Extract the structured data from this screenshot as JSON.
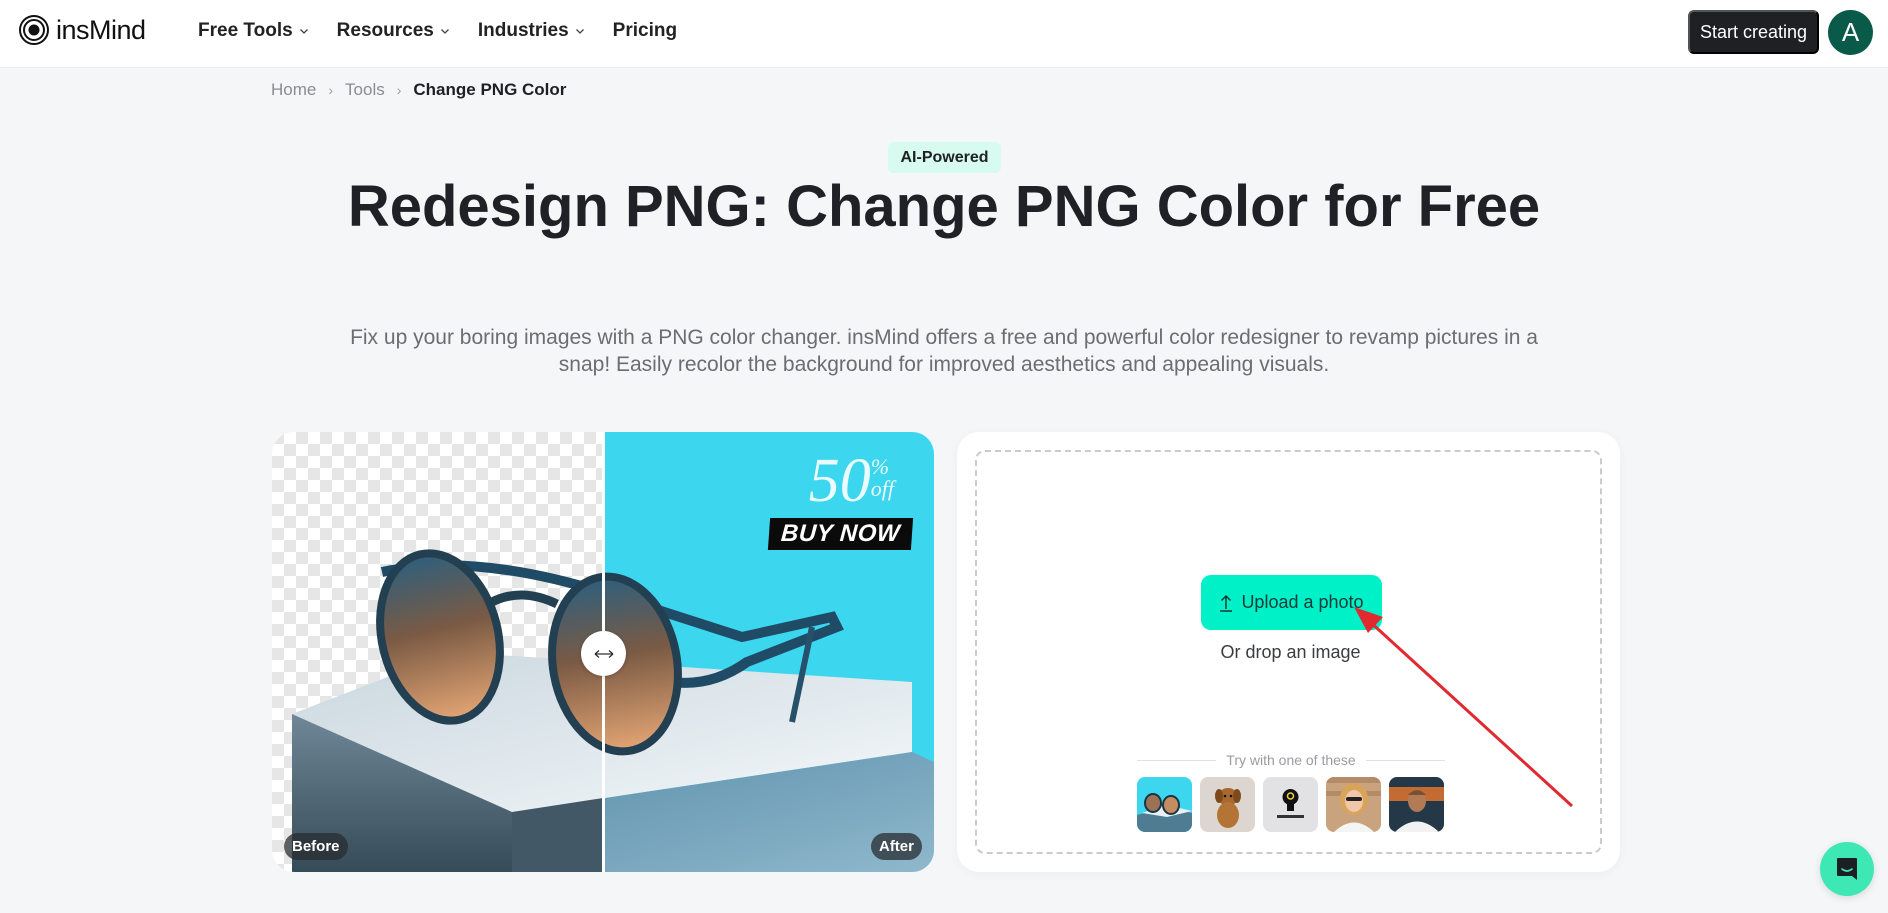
{
  "nav": {
    "brand": "insMind",
    "menu": [
      {
        "label": "Free Tools",
        "has_dropdown": true
      },
      {
        "label": "Resources",
        "has_dropdown": true
      },
      {
        "label": "Industries",
        "has_dropdown": true
      },
      {
        "label": "Pricing",
        "has_dropdown": false
      }
    ],
    "cta_label": "Start creating",
    "avatar_initial": "A"
  },
  "breadcrumb": {
    "items": [
      "Home",
      "Tools"
    ],
    "current": "Change PNG Color"
  },
  "hero": {
    "badge": "AI-Powered",
    "title": "Redesign PNG: Change PNG Color for Free",
    "subtitle": "Fix up your boring images with a PNG color changer. insMind offers a free and powerful color redesigner to revamp pictures in a snap! Easily recolor the background for improved aesthetics and appealing visuals."
  },
  "comparison": {
    "before_label": "Before",
    "after_label": "After",
    "promo_number": "50",
    "promo_percent": "%",
    "promo_off": "off",
    "promo_cta": "BUY NOW",
    "slider_position": 0.5,
    "after_bg_color": "#3dd6ef"
  },
  "upload": {
    "button_label": "Upload a photo",
    "drop_text": "Or drop an image",
    "try_text": "Try with one of these",
    "samples": [
      {
        "name": "sunglasses-sample"
      },
      {
        "name": "puppy-sample"
      },
      {
        "name": "lightbulb-logo-sample"
      },
      {
        "name": "woman-sunglasses-sample"
      },
      {
        "name": "man-portrait-sample"
      }
    ],
    "accent_color": "#00f0c8"
  },
  "colors": {
    "page_bg": "#f5f6f8",
    "annotation_arrow": "#e02a2f",
    "chat_button": "#3ee8b5"
  }
}
